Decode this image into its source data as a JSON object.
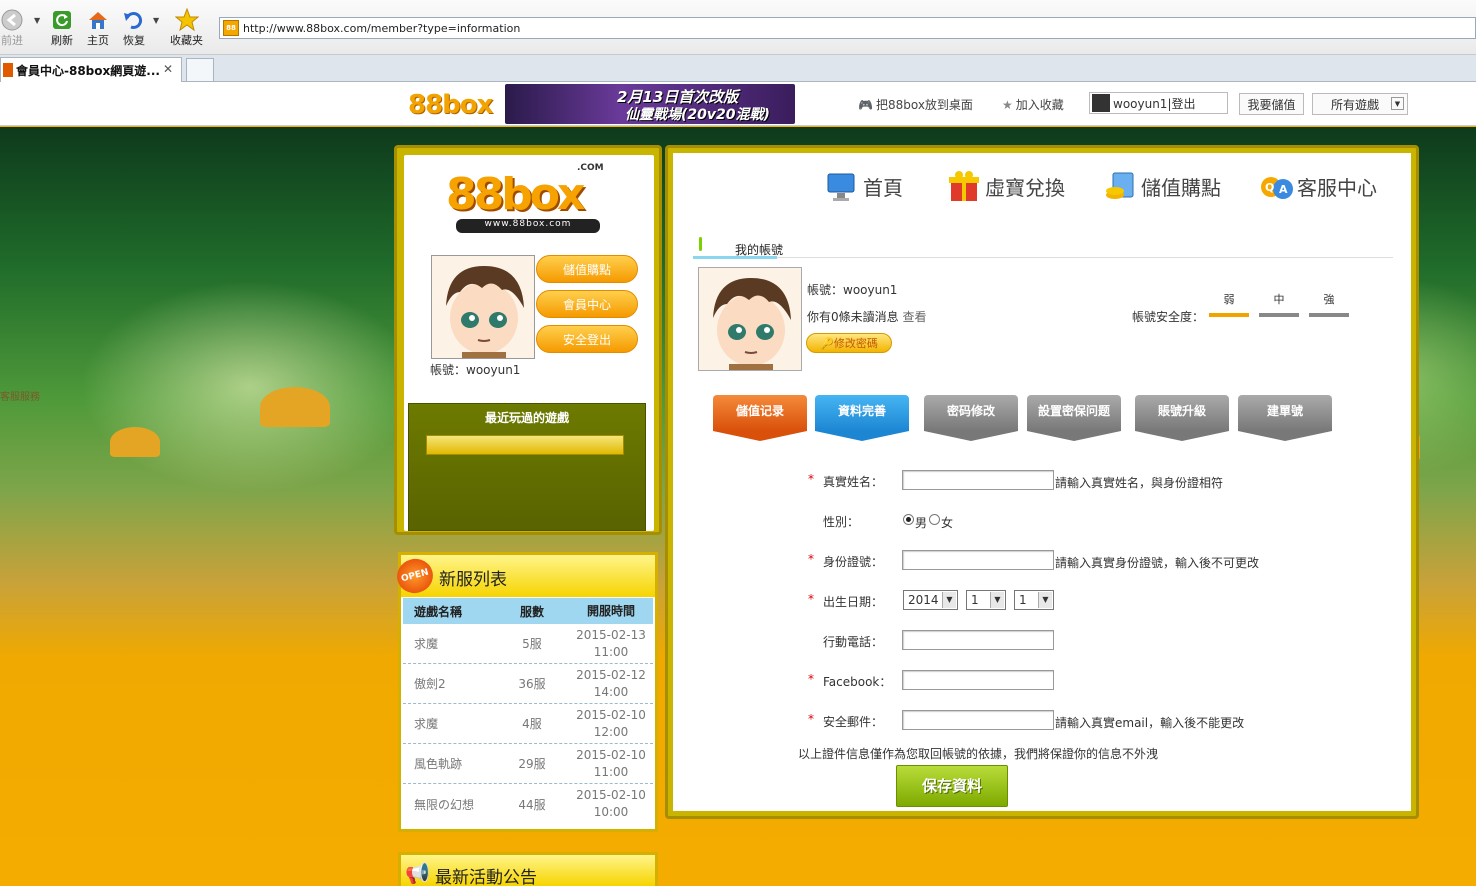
{
  "browser": {
    "buttons": {
      "back": "前进",
      "refresh": "刷新",
      "home": "主页",
      "restore": "恢复",
      "favorites": "收藏夹"
    },
    "url": "http://www.88box.com/member?type=information",
    "tab_title": "會員中心-88box網頁遊..."
  },
  "topbar": {
    "banner_line1": "2月13日首次改版",
    "banner_line2": "仙靈戰場(20v20混戰)",
    "links": {
      "desktop": "把88box放到桌面",
      "bookmark": "加入收藏"
    },
    "user": "wooyun1|登出",
    "deposit": "我要儲值",
    "all_games": "所有遊戲"
  },
  "sidebar": {
    "logo_com": ".COM",
    "logo_url": "www.88box.com",
    "buttons": {
      "deposit": "儲值購點",
      "member": "會員中心",
      "logout": "安全登出"
    },
    "account_label": "帳號：wooyun1",
    "recent_title": "最近玩過的遊戲",
    "side_text": "客服服務"
  },
  "newlist": {
    "badge": "OPEN",
    "title": "新服列表",
    "headers": [
      "遊戲名稱",
      "服數",
      "開服時間"
    ],
    "rows": [
      {
        "name": "求魔",
        "server": "5服",
        "date": "2015-02-13",
        "time": "11:00"
      },
      {
        "name": "傲劍2",
        "server": "36服",
        "date": "2015-02-12",
        "time": "14:00"
      },
      {
        "name": "求魔",
        "server": "4服",
        "date": "2015-02-10",
        "time": "12:00"
      },
      {
        "name": "風色軌跡",
        "server": "29服",
        "date": "2015-02-10",
        "time": "11:00"
      },
      {
        "name": "無限の幻想",
        "server": "44服",
        "date": "2015-02-10",
        "time": "10:00"
      }
    ]
  },
  "events": {
    "title": "最新活動公告"
  },
  "nav": {
    "home": "首頁",
    "exchange": "虛寶兌換",
    "store": "儲值購點",
    "support": "客服中心"
  },
  "account": {
    "tab": "我的帳號",
    "username_line": "帳號：wooyun1",
    "msg_line": "你有0條未讀消息",
    "msg_view": "查看",
    "change_pw": "修改密碼",
    "security_label": "帳號安全度：",
    "levels": [
      "弱",
      "中",
      "強"
    ]
  },
  "func_tabs": [
    "儲值记录",
    "資料完善",
    "密码修改",
    "設置密保问题",
    "賬號升級",
    "建單號"
  ],
  "form": {
    "realname_label": "真實姓名：",
    "realname_hint": "請輸入真實姓名，與身份證相符",
    "gender_label": "性別：",
    "gender_male": "男",
    "gender_female": "女",
    "id_label": "身份證號：",
    "id_hint": "請輸入真實身份證號，輸入後不可更改",
    "birth_label": "出生日期：",
    "birth_year": "2014",
    "birth_month": "1",
    "birth_day": "1",
    "phone_label": "行動電話：",
    "facebook_label": "Facebook：",
    "email_label": "安全郵件：",
    "email_hint": "請輸入真實email，輸入後不能更改",
    "notice": "以上證件信息僅作為您取回帳號的依據，我們將保證你的信息不外洩",
    "save": "保存資料",
    "req_mark": "*"
  },
  "colors": {
    "accent": "#f4b400",
    "orange_tab": "#d9500b",
    "blue_tab": "#1d86d3",
    "save_green": "#8cb800"
  }
}
